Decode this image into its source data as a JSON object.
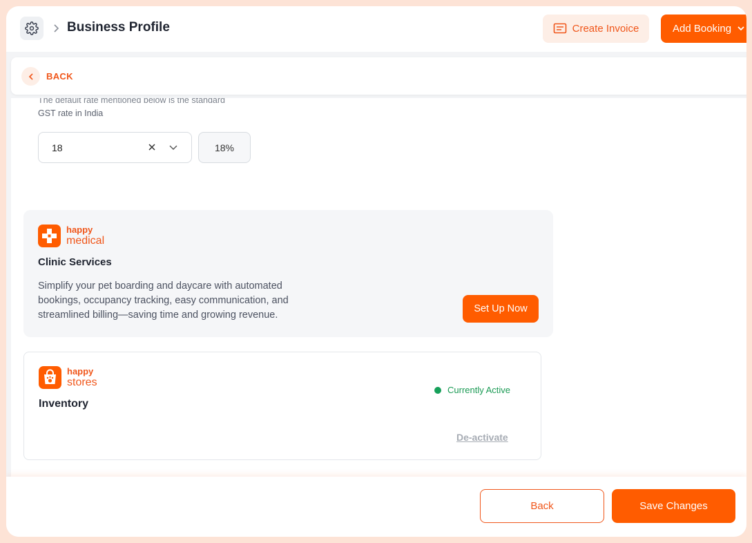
{
  "header": {
    "title": "Business Profile",
    "create_invoice_label": "Create Invoice",
    "add_booking_label": "Add Booking"
  },
  "back_strip": {
    "label": "BACK"
  },
  "gst": {
    "note_line1": "The default rate mentioned below is the standard",
    "note_line2": "GST rate in India",
    "selected_value": "18",
    "percent_display": "18%"
  },
  "clinic_card": {
    "logo_line1": "happy",
    "logo_line2": "medical",
    "title": "Clinic Services",
    "description": "Simplify your pet boarding and daycare with automated bookings, occupancy tracking, easy communication, and streamlined billing—saving time and growing revenue.",
    "button_label": "Set Up Now"
  },
  "inventory_card": {
    "logo_line1": "happy",
    "logo_line2": "stores",
    "title": "Inventory",
    "status": "Currently Active",
    "deactivate_label": "De-activate"
  },
  "footer": {
    "back_label": "Back",
    "save_label": "Save Changes"
  },
  "colors": {
    "accent": "#ff5c00",
    "accent_text": "#f0561a",
    "active_green": "#16a05a"
  }
}
